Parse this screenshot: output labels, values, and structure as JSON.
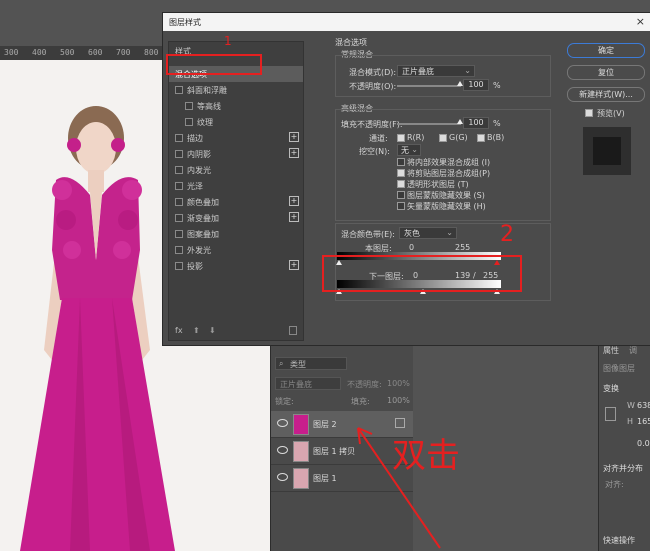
{
  "ruler": {
    "ticks": [
      "300",
      "400",
      "500",
      "600",
      "700",
      "800"
    ]
  },
  "dialog": {
    "title": "图层样式",
    "close": "×",
    "sidebar": {
      "header": "样式",
      "items": [
        {
          "label": "混合选项",
          "check": false,
          "plus": false
        },
        {
          "label": "斜面和浮雕",
          "check": true,
          "plus": false
        },
        {
          "label": "等高线",
          "check": true,
          "plus": false
        },
        {
          "label": "纹理",
          "check": true,
          "plus": false
        },
        {
          "label": "描边",
          "check": true,
          "plus": true
        },
        {
          "label": "内阴影",
          "check": true,
          "plus": true
        },
        {
          "label": "内发光",
          "check": true,
          "plus": false
        },
        {
          "label": "光泽",
          "check": true,
          "plus": false
        },
        {
          "label": "颜色叠加",
          "check": true,
          "plus": true
        },
        {
          "label": "渐变叠加",
          "check": true,
          "plus": true
        },
        {
          "label": "图案叠加",
          "check": true,
          "plus": false
        },
        {
          "label": "外发光",
          "check": true,
          "plus": false
        },
        {
          "label": "投影",
          "check": true,
          "plus": true
        }
      ],
      "footer": {
        "fx": "fx",
        "up": "⬆",
        "down": "⬇",
        "trash": "🗑"
      }
    },
    "blend": {
      "section_title": "混合选项",
      "general_title": "常规混合",
      "mode_label": "混合模式(D):",
      "mode_value": "正片叠底",
      "opacity_label": "不透明度(O):",
      "opacity_value": "100",
      "percent": "%",
      "advanced_title": "高级混合",
      "fill_label": "填充不透明度(F):",
      "fill_value": "100",
      "channels_label": "通道:",
      "channel_r": "R(R)",
      "channel_g": "G(G)",
      "channel_b": "B(B)",
      "knockout_label": "挖空(N):",
      "knockout_value": "无",
      "opt1": "将内部效果混合成组 (I)",
      "opt2": "将剪贴图层混合成组(P)",
      "opt3": "透明形状图层 (T)",
      "opt4": "图层蒙版隐藏效果 (S)",
      "opt5": "矢量蒙版隐藏效果 (H)",
      "band_label": "混合颜色带(E):",
      "band_value": "灰色",
      "this_layer": "本图层:",
      "this_min": "0",
      "this_max": "255",
      "under_layer": "下一图层:",
      "under_min": "0",
      "under_mid": "139",
      "under_slash": "/",
      "under_max": "255"
    },
    "buttons": {
      "ok": "确定",
      "reset": "复位",
      "new_style": "新建样式(W)...",
      "preview": "预览(V)"
    }
  },
  "layers": {
    "search": "类型",
    "blend_mode": "正片叠底",
    "opacity_label": "不透明度:",
    "opacity_value": "100%",
    "lock_label": "锁定:",
    "fill_label": "填充:",
    "fill_value": "100%",
    "items": [
      "图层 2",
      "图层 1 拷贝",
      "图层 1"
    ]
  },
  "props": {
    "tab1": "属性",
    "tab2": "调",
    "doc": "图像图层",
    "transform": "变换",
    "w_label": "W",
    "w_value": "638",
    "h_label": "H",
    "h_value": "165",
    "angle": "0.0",
    "align": "对齐并分布",
    "align_sub": "对齐:",
    "quick": "快速操作"
  },
  "annotations": {
    "n1": "1",
    "n2": "2",
    "handwriting": "双击"
  }
}
